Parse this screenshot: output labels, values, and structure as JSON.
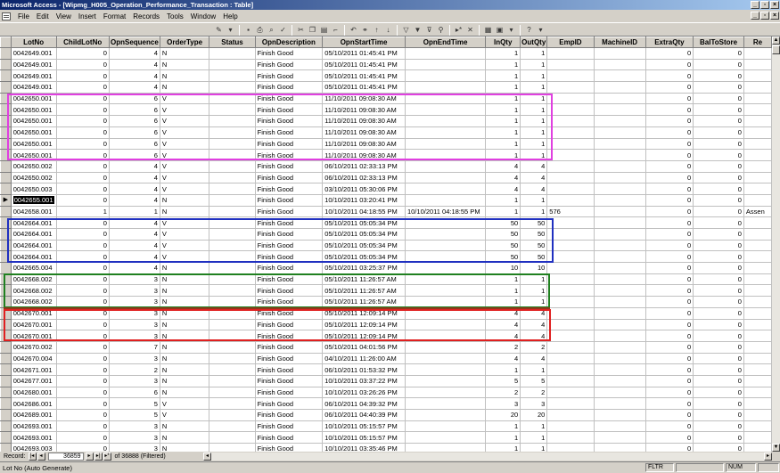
{
  "window": {
    "title": "Microsoft Access - [Wipmg_H005_Operation_Performance_Transaction : Table]"
  },
  "menu": [
    "File",
    "Edit",
    "View",
    "Insert",
    "Format",
    "Records",
    "Tools",
    "Window",
    "Help"
  ],
  "grid": {
    "columns": [
      "LotNo",
      "ChildLotNo",
      "OpnSequence",
      "OrderType",
      "Status",
      "OpnDescription",
      "OpnStartTime",
      "OpnEndTime",
      "InQty",
      "OutQty",
      "EmpID",
      "MachineID",
      "ExtraQty",
      "BalToStore",
      "Re"
    ],
    "rows": [
      [
        "0042649.001",
        "0",
        "4",
        "N",
        "",
        "Finish Good",
        "05/10/2011 01:45:41 PM",
        "",
        "1",
        "1",
        "",
        "",
        "0",
        "0",
        ""
      ],
      [
        "0042649.001",
        "0",
        "4",
        "N",
        "",
        "Finish Good",
        "05/10/2011 01:45:41 PM",
        "",
        "1",
        "1",
        "",
        "",
        "0",
        "0",
        ""
      ],
      [
        "0042649.001",
        "0",
        "4",
        "N",
        "",
        "Finish Good",
        "05/10/2011 01:45:41 PM",
        "",
        "1",
        "1",
        "",
        "",
        "0",
        "0",
        ""
      ],
      [
        "0042649.001",
        "0",
        "4",
        "N",
        "",
        "Finish Good",
        "05/10/2011 01:45:41 PM",
        "",
        "1",
        "1",
        "",
        "",
        "0",
        "0",
        ""
      ],
      [
        "0042650.001",
        "0",
        "6",
        "V",
        "",
        "Finish Good",
        "11/10/2011 09:08:30 AM",
        "",
        "1",
        "1",
        "",
        "",
        "0",
        "0",
        ""
      ],
      [
        "0042650.001",
        "0",
        "6",
        "V",
        "",
        "Finish Good",
        "11/10/2011 09:08:30 AM",
        "",
        "1",
        "1",
        "",
        "",
        "0",
        "0",
        ""
      ],
      [
        "0042650.001",
        "0",
        "6",
        "V",
        "",
        "Finish Good",
        "11/10/2011 09:08:30 AM",
        "",
        "1",
        "1",
        "",
        "",
        "0",
        "0",
        ""
      ],
      [
        "0042650.001",
        "0",
        "6",
        "V",
        "",
        "Finish Good",
        "11/10/2011 09:08:30 AM",
        "",
        "1",
        "1",
        "",
        "",
        "0",
        "0",
        ""
      ],
      [
        "0042650.001",
        "0",
        "6",
        "V",
        "",
        "Finish Good",
        "11/10/2011 09:08:30 AM",
        "",
        "1",
        "1",
        "",
        "",
        "0",
        "0",
        ""
      ],
      [
        "0042650.001",
        "0",
        "6",
        "V",
        "",
        "Finish Good",
        "11/10/2011 09:08:30 AM",
        "",
        "1",
        "1",
        "",
        "",
        "0",
        "0",
        ""
      ],
      [
        "0042650.002",
        "0",
        "4",
        "V",
        "",
        "Finish Good",
        "06/10/2011 02:33:13 PM",
        "",
        "4",
        "4",
        "",
        "",
        "0",
        "0",
        ""
      ],
      [
        "0042650.002",
        "0",
        "4",
        "V",
        "",
        "Finish Good",
        "06/10/2011 02:33:13 PM",
        "",
        "4",
        "4",
        "",
        "",
        "0",
        "0",
        ""
      ],
      [
        "0042650.003",
        "0",
        "4",
        "V",
        "",
        "Finish Good",
        "03/10/2011 05:30:06 PM",
        "",
        "4",
        "4",
        "",
        "",
        "0",
        "0",
        ""
      ],
      [
        "0042655.001",
        "0",
        "4",
        "N",
        "",
        "Finish Good",
        "10/10/2011 03:20:41 PM",
        "",
        "1",
        "1",
        "",
        "",
        "0",
        "0",
        ""
      ],
      [
        "0042658.001",
        "1",
        "1",
        "N",
        "",
        "Finish Good",
        "10/10/2011 04:18:55 PM",
        "10/10/2011 04:18:55 PM",
        "1",
        "1",
        "576",
        "",
        "0",
        "0",
        "Assen"
      ],
      [
        "0042664.001",
        "0",
        "4",
        "V",
        "",
        "Finish Good",
        "05/10/2011 05:05:34 PM",
        "",
        "50",
        "50",
        "",
        "",
        "0",
        "0",
        ""
      ],
      [
        "0042664.001",
        "0",
        "4",
        "V",
        "",
        "Finish Good",
        "05/10/2011 05:05:34 PM",
        "",
        "50",
        "50",
        "",
        "",
        "0",
        "0",
        ""
      ],
      [
        "0042664.001",
        "0",
        "4",
        "V",
        "",
        "Finish Good",
        "05/10/2011 05:05:34 PM",
        "",
        "50",
        "50",
        "",
        "",
        "0",
        "0",
        ""
      ],
      [
        "0042664.001",
        "0",
        "4",
        "V",
        "",
        "Finish Good",
        "05/10/2011 05:05:34 PM",
        "",
        "50",
        "50",
        "",
        "",
        "0",
        "0",
        ""
      ],
      [
        "0042665.004",
        "0",
        "4",
        "N",
        "",
        "Finish Good",
        "05/10/2011 03:25:37 PM",
        "",
        "10",
        "10",
        "",
        "",
        "0",
        "0",
        ""
      ],
      [
        "0042668.002",
        "0",
        "3",
        "N",
        "",
        "Finish Good",
        "05/10/2011 11:26:57 AM",
        "",
        "1",
        "1",
        "",
        "",
        "0",
        "0",
        ""
      ],
      [
        "0042668.002",
        "0",
        "3",
        "N",
        "",
        "Finish Good",
        "05/10/2011 11:26:57 AM",
        "",
        "1",
        "1",
        "",
        "",
        "0",
        "0",
        ""
      ],
      [
        "0042668.002",
        "0",
        "3",
        "N",
        "",
        "Finish Good",
        "05/10/2011 11:26:57 AM",
        "",
        "1",
        "1",
        "",
        "",
        "0",
        "0",
        ""
      ],
      [
        "0042670.001",
        "0",
        "3",
        "N",
        "",
        "Finish Good",
        "05/10/2011 12:09:14 PM",
        "",
        "4",
        "4",
        "",
        "",
        "0",
        "0",
        ""
      ],
      [
        "0042670.001",
        "0",
        "3",
        "N",
        "",
        "Finish Good",
        "05/10/2011 12:09:14 PM",
        "",
        "4",
        "4",
        "",
        "",
        "0",
        "0",
        ""
      ],
      [
        "0042670.001",
        "0",
        "3",
        "N",
        "",
        "Finish Good",
        "05/10/2011 12:09:14 PM",
        "",
        "4",
        "4",
        "",
        "",
        "0",
        "0",
        ""
      ],
      [
        "0042670.002",
        "0",
        "7",
        "N",
        "",
        "Finish Good",
        "05/10/2011 04:01:56 PM",
        "",
        "2",
        "2",
        "",
        "",
        "0",
        "0",
        ""
      ],
      [
        "0042670.004",
        "0",
        "3",
        "N",
        "",
        "Finish Good",
        "04/10/2011 11:26:00 AM",
        "",
        "4",
        "4",
        "",
        "",
        "0",
        "0",
        ""
      ],
      [
        "0042671.001",
        "0",
        "2",
        "N",
        "",
        "Finish Good",
        "06/10/2011 01:53:32 PM",
        "",
        "1",
        "1",
        "",
        "",
        "0",
        "0",
        ""
      ],
      [
        "0042677.001",
        "0",
        "3",
        "N",
        "",
        "Finish Good",
        "10/10/2011 03:37:22 PM",
        "",
        "5",
        "5",
        "",
        "",
        "0",
        "0",
        ""
      ],
      [
        "0042680.001",
        "0",
        "6",
        "N",
        "",
        "Finish Good",
        "10/10/2011 03:26:26 PM",
        "",
        "2",
        "2",
        "",
        "",
        "0",
        "0",
        ""
      ],
      [
        "0042686.001",
        "0",
        "5",
        "V",
        "",
        "Finish Good",
        "06/10/2011 04:39:32 PM",
        "",
        "3",
        "3",
        "",
        "",
        "0",
        "0",
        ""
      ],
      [
        "0042689.001",
        "0",
        "5",
        "V",
        "",
        "Finish Good",
        "06/10/2011 04:40:39 PM",
        "",
        "20",
        "20",
        "",
        "",
        "0",
        "0",
        ""
      ],
      [
        "0042693.001",
        "0",
        "3",
        "N",
        "",
        "Finish Good",
        "10/10/2011 05:15:57 PM",
        "",
        "1",
        "1",
        "",
        "",
        "0",
        "0",
        ""
      ],
      [
        "0042693.001",
        "0",
        "3",
        "N",
        "",
        "Finish Good",
        "10/10/2011 05:15:57 PM",
        "",
        "1",
        "1",
        "",
        "",
        "0",
        "0",
        ""
      ],
      [
        "0042693.003",
        "0",
        "3",
        "N",
        "",
        "Finish Good",
        "10/10/2011 03:35:46 PM",
        "",
        "1",
        "1",
        "",
        "",
        "0",
        "0",
        ""
      ]
    ],
    "current_row_index": 13
  },
  "highlights": [
    {
      "name": "magenta-highlight",
      "color": "#e040e0"
    },
    {
      "name": "blue-highlight",
      "color": "#2030c0"
    },
    {
      "name": "green-highlight",
      "color": "#208020"
    },
    {
      "name": "brown-highlight",
      "color": "#8b3a1a"
    },
    {
      "name": "red-highlight",
      "color": "#e02020"
    }
  ],
  "navigator": {
    "label": "Record:",
    "current": "36859",
    "total_text": "of 36888 (Filtered)"
  },
  "status": {
    "text": "Lot No (Auto Generate)",
    "fltr": "FLTR",
    "num": "NUM"
  }
}
